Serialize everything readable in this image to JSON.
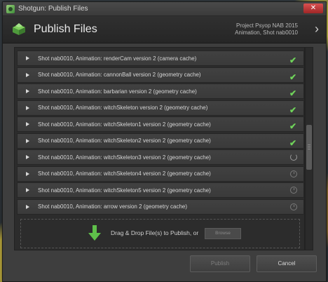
{
  "window": {
    "title": "Shotgun: Publish Files",
    "close_label": "✕"
  },
  "header": {
    "title": "Publish Files",
    "info_line1": "Project Psyop NAB 2015",
    "info_line2": "Animation, Shot nab0010",
    "next_icon": "chevron-right-icon"
  },
  "items": [
    {
      "label": "Shot nab0010, Animation: renderCam version 2 (camera cache)",
      "status": "done"
    },
    {
      "label": "Shot nab0010, Animation: cannonBall version 2 (geometry cache)",
      "status": "done"
    },
    {
      "label": "Shot nab0010, Animation: barbarian version 2 (geometry cache)",
      "status": "done"
    },
    {
      "label": "Shot nab0010, Animation: witchSkeleton version 2 (geometry cache)",
      "status": "done"
    },
    {
      "label": "Shot nab0010, Animation: witchSkeleton1 version 2 (geometry cache)",
      "status": "done"
    },
    {
      "label": "Shot nab0010, Animation: witchSkeleton2 version 2 (geometry cache)",
      "status": "done"
    },
    {
      "label": "Shot nab0010, Animation: witchSkeleton3 version 2 (geometry cache)",
      "status": "in-progress"
    },
    {
      "label": "Shot nab0010, Animation: witchSkeleton4 version 2 (geometry cache)",
      "status": "pending"
    },
    {
      "label": "Shot nab0010, Animation: witchSkeleton5 version 2 (geometry cache)",
      "status": "pending"
    },
    {
      "label": "Shot nab0010, Animation: arrow version 2 (geometry cache)",
      "status": "pending"
    }
  ],
  "dropzone": {
    "text": "Drag & Drop File(s) to Publish, or",
    "browse_label": "Browse"
  },
  "footer": {
    "publish_label": "Publish",
    "cancel_label": "Cancel"
  },
  "colors": {
    "check": "#6fd35a",
    "accent_green": "#5fc04a"
  }
}
